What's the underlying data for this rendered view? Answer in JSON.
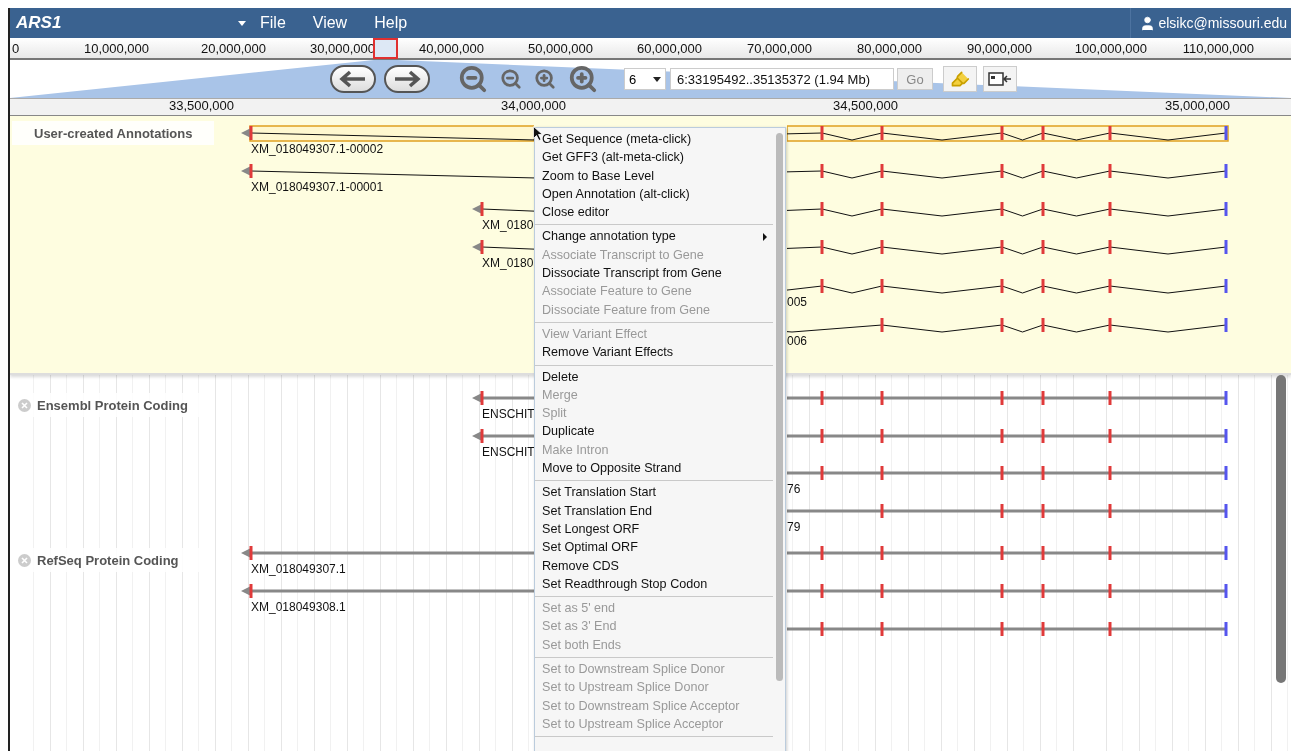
{
  "app": {
    "title": "ARS1",
    "menus": [
      {
        "label": "File"
      },
      {
        "label": "View"
      },
      {
        "label": "Help"
      }
    ],
    "user": "elsikc@missouri.edu"
  },
  "overview_ruler": {
    "labels": [
      "0",
      "10,000,000",
      "20,000,000",
      "30,000,000",
      "40,000,000",
      "50,000,000",
      "60,000,000",
      "70,000,000",
      "80,000,000",
      "90,000,000",
      "100,000,000",
      "110,000,000"
    ]
  },
  "navigation": {
    "refseq": "6",
    "location": "6:33195492..35135372 (1.94 Mb)",
    "go": "Go"
  },
  "detail_ruler": {
    "labels": [
      "33,500,000",
      "34,000,000",
      "34,500,000",
      "35,000,000"
    ]
  },
  "tracks": [
    {
      "kind": "annotation",
      "label": "User-created Annotations",
      "closable": false,
      "features": [
        {
          "label": "XM_018049307.1-00002",
          "selected": true
        },
        {
          "label": "XM_018049307.1-00001",
          "selected": false
        },
        {
          "label": "XM_0180",
          "selected": false
        },
        {
          "label": "XM_0180",
          "selected": false
        },
        {
          "label": "005",
          "selected": false
        },
        {
          "label": "006",
          "selected": false
        }
      ]
    },
    {
      "kind": "evidence",
      "label": "Ensembl Protein Coding",
      "closable": true,
      "features": [
        {
          "label": "ENSCHIT",
          "selected": false
        },
        {
          "label": "ENSCHIT",
          "selected": false
        },
        {
          "label": "76",
          "selected": false
        },
        {
          "label": "79",
          "selected": false
        }
      ]
    },
    {
      "kind": "evidence",
      "label": "RefSeq Protein Coding",
      "closable": true,
      "features": [
        {
          "label": "XM_018049307.1",
          "selected": false
        },
        {
          "label": "XM_018049308.1",
          "selected": false
        },
        {
          "selected": false
        }
      ]
    }
  ],
  "context_menu": {
    "groups": [
      [
        {
          "label": "Get Sequence (meta-click)",
          "disabled": false,
          "submenu": false
        },
        {
          "label": "Get GFF3 (alt-meta-click)",
          "disabled": false,
          "submenu": false
        },
        {
          "label": "Zoom to Base Level",
          "disabled": false,
          "submenu": false
        },
        {
          "label": "Open Annotation (alt-click)",
          "disabled": false,
          "submenu": false
        },
        {
          "label": "Close editor",
          "disabled": false,
          "submenu": false
        }
      ],
      [
        {
          "label": "Change annotation type",
          "disabled": false,
          "submenu": true
        },
        {
          "label": "Associate Transcript to Gene",
          "disabled": true,
          "submenu": false
        },
        {
          "label": "Dissociate Transcript from Gene",
          "disabled": false,
          "submenu": false
        },
        {
          "label": "Associate Feature to Gene",
          "disabled": true,
          "submenu": false
        },
        {
          "label": "Dissociate Feature from Gene",
          "disabled": true,
          "submenu": false
        }
      ],
      [
        {
          "label": "View Variant Effect",
          "disabled": true,
          "submenu": false
        },
        {
          "label": "Remove Variant Effects",
          "disabled": false,
          "submenu": false
        }
      ],
      [
        {
          "label": "Delete",
          "disabled": false,
          "submenu": false
        },
        {
          "label": "Merge",
          "disabled": true,
          "submenu": false
        },
        {
          "label": "Split",
          "disabled": true,
          "submenu": false
        },
        {
          "label": "Duplicate",
          "disabled": false,
          "submenu": false
        },
        {
          "label": "Make Intron",
          "disabled": true,
          "submenu": false
        },
        {
          "label": "Move to Opposite Strand",
          "disabled": false,
          "submenu": false
        }
      ],
      [
        {
          "label": "Set Translation Start",
          "disabled": false,
          "submenu": false
        },
        {
          "label": "Set Translation End",
          "disabled": false,
          "submenu": false
        },
        {
          "label": "Set Longest ORF",
          "disabled": false,
          "submenu": false
        },
        {
          "label": "Set Optimal ORF",
          "disabled": false,
          "submenu": false
        },
        {
          "label": "Remove CDS",
          "disabled": false,
          "submenu": false
        },
        {
          "label": "Set Readthrough Stop Codon",
          "disabled": false,
          "submenu": false
        }
      ],
      [
        {
          "label": "Set as 5' end",
          "disabled": true,
          "submenu": false
        },
        {
          "label": "Set as 3' End",
          "disabled": true,
          "submenu": false
        },
        {
          "label": "Set both Ends",
          "disabled": true,
          "submenu": false
        }
      ],
      [
        {
          "label": "Set to Downstream Splice Donor",
          "disabled": true,
          "submenu": false
        },
        {
          "label": "Set to Upstream Splice Donor",
          "disabled": true,
          "submenu": false
        },
        {
          "label": "Set to Downstream Splice Acceptor",
          "disabled": true,
          "submenu": false
        },
        {
          "label": "Set to Upstream Splice Acceptor",
          "disabled": true,
          "submenu": false
        }
      ]
    ]
  }
}
